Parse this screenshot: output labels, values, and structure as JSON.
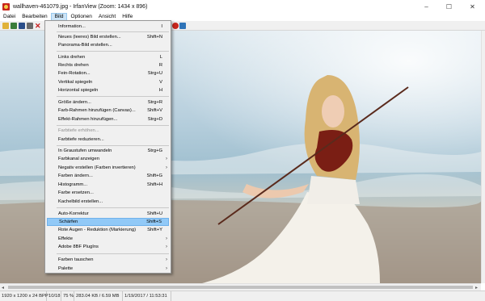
{
  "window": {
    "title": "wallhaven-461079.jpg - IrfanView (Zoom: 1434 x 896)",
    "minimize": "–",
    "maximize": "☐",
    "close": "✕"
  },
  "menubar": [
    "Datei",
    "Bearbeiten",
    "Bild",
    "Optionen",
    "Ansicht",
    "Hilfe"
  ],
  "toolbar_icons": [
    "open-icon",
    "slideshow-icon",
    "save-icon",
    "print-icon",
    "delete-icon",
    "info-icon",
    "rotate-icon",
    "thumbnails-icon"
  ],
  "image_menu": {
    "items": [
      {
        "label": "Information...",
        "shortcut": "I"
      },
      {
        "label": "Neues (leeres) Bild erstellen...",
        "shortcut": "Shift+N"
      },
      {
        "label": "Panorama-Bild erstellen...",
        "shortcut": ""
      },
      {
        "label": "Links drehen",
        "shortcut": "L"
      },
      {
        "label": "Rechts drehen",
        "shortcut": "R"
      },
      {
        "label": "Fein-Rotation...",
        "shortcut": "Strg+U"
      },
      {
        "label": "Vertikal spiegeln",
        "shortcut": "V"
      },
      {
        "label": "Horizontal spiegeln",
        "shortcut": "H"
      },
      {
        "label": "Größe ändern...",
        "shortcut": "Strg+R"
      },
      {
        "label": "Farb-Rahmen hinzufügen (Canvas)...",
        "shortcut": "Shift+V"
      },
      {
        "label": "Effekt-Rahmen hinzufügen...",
        "shortcut": "Strg+D"
      },
      {
        "label": "Farbtiefe erhöhen...",
        "shortcut": ""
      },
      {
        "label": "Farbtiefe reduzieren...",
        "shortcut": ""
      },
      {
        "label": "In Graustufen umwandeln",
        "shortcut": "Strg+G"
      },
      {
        "label": "Farbkanal anzeigen",
        "shortcut": ""
      },
      {
        "label": "Negativ erstellen (Farben invertieren)",
        "shortcut": ""
      },
      {
        "label": "Farben ändern...",
        "shortcut": "Shift+G"
      },
      {
        "label": "Histogramm...",
        "shortcut": "Shift+H"
      },
      {
        "label": "Farbe ersetzen...",
        "shortcut": ""
      },
      {
        "label": "Kachelbild erstellen...",
        "shortcut": ""
      },
      {
        "label": "Auto-Korrektur",
        "shortcut": "Shift+U"
      },
      {
        "label": "Schärfen",
        "shortcut": "Shift+S"
      },
      {
        "label": "Rote Augen - Reduktion (Markierung)",
        "shortcut": "Shift+Y"
      },
      {
        "label": "Effekte",
        "shortcut": ""
      },
      {
        "label": "Adobe 8BF PlugIns",
        "shortcut": ""
      },
      {
        "label": "Farben tauschen",
        "shortcut": ""
      },
      {
        "label": "Palette",
        "shortcut": ""
      }
    ],
    "submenu_arrow": "›"
  },
  "statusbar": [
    "1920 x 1200 x 24 BPP",
    "10/18",
    "75 %",
    "283.04 KB / 6.59 MB",
    "1/19/2017 / 11:53:31"
  ]
}
